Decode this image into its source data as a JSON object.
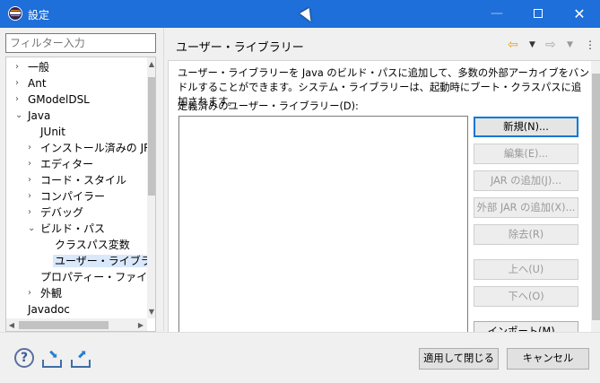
{
  "window": {
    "title": "設定",
    "minimize_glyph": "—",
    "close_glyph": "✕"
  },
  "filter": {
    "placeholder": "フィルター入力"
  },
  "tree": [
    {
      "label": "一般",
      "toggle": "›",
      "depth": 0
    },
    {
      "label": "Ant",
      "toggle": "›",
      "depth": 0
    },
    {
      "label": "GModelDSL",
      "toggle": "›",
      "depth": 0
    },
    {
      "label": "Java",
      "toggle": "⌄",
      "depth": 0
    },
    {
      "label": "JUnit",
      "toggle": "",
      "depth": 1
    },
    {
      "label": "インストール済みの JRE",
      "toggle": "›",
      "depth": 1
    },
    {
      "label": "エディター",
      "toggle": "›",
      "depth": 1
    },
    {
      "label": "コード・スタイル",
      "toggle": "›",
      "depth": 1
    },
    {
      "label": "コンパイラー",
      "toggle": "›",
      "depth": 1
    },
    {
      "label": "デバッグ",
      "toggle": "›",
      "depth": 1
    },
    {
      "label": "ビルド・パス",
      "toggle": "⌄",
      "depth": 1
    },
    {
      "label": "クラスパス変数",
      "toggle": "",
      "depth": 2
    },
    {
      "label": "ユーザー・ライブラリー",
      "toggle": "",
      "depth": 2
    },
    {
      "label": "プロパティー・ファイル・エディ",
      "toggle": "",
      "depth": 1
    },
    {
      "label": "外観",
      "toggle": "›",
      "depth": 1
    },
    {
      "label": "Javadoc",
      "toggle": "",
      "depth": 0
    }
  ],
  "page": {
    "title": "ユーザー・ライブラリー",
    "description": "ユーザー・ライブラリーを Java のビルド・パスに追加して、多数の外部アーカイブをバンドルすることができます。システム・ライブラリーは、起動時にブート・クラスパスに追加されます。",
    "list_label": "定義済みのユーザー・ライブラリー(D):"
  },
  "nav": {
    "back": "⇦",
    "forward": "⇨",
    "dropdown": "▼",
    "menu": "⋮"
  },
  "side_buttons": [
    {
      "label": "新規(N)...",
      "state": "enabled"
    },
    {
      "label": "編集(E)...",
      "state": "disabled"
    },
    {
      "label": "JAR の追加(J)...",
      "state": "disabled"
    },
    {
      "label": "外部 JAR の追加(X)...",
      "state": "disabled"
    },
    {
      "label": "除去(R)",
      "state": "disabled"
    },
    {
      "label": "上へ(U)",
      "state": "disabled"
    },
    {
      "label": "下へ(O)",
      "state": "disabled"
    },
    {
      "label": "インポート(M)...",
      "state": "enabled"
    }
  ],
  "footer": {
    "help_glyph": "?",
    "apply_close": "適用して閉じる",
    "cancel": "キャンセル"
  }
}
